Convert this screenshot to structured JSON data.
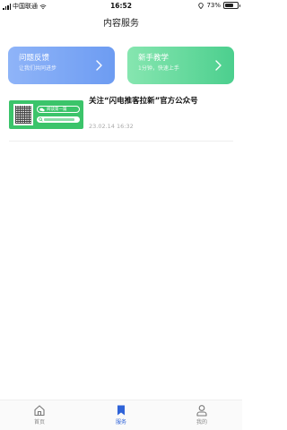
{
  "status_bar": {
    "carrier": "中国联通",
    "time": "16:52",
    "battery": "73%",
    "battery_level": 0.73
  },
  "header": {
    "title": "内容服务"
  },
  "cards": {
    "feedback": {
      "title": "问题反馈",
      "subtitle": "让我们共同进步",
      "color": "#7aa6f5"
    },
    "guide": {
      "title": "新手教学",
      "subtitle": "1分钟，快速上手",
      "color": "#5fd89a"
    }
  },
  "articles": [
    {
      "title": "关注“闪电推客拉新”官方公众号",
      "date": "23.02.14 16:32",
      "thumb_label": "阅读第一篇"
    }
  ],
  "tabbar": {
    "items": [
      {
        "label": "首页",
        "icon": "home-icon",
        "active": false
      },
      {
        "label": "服务",
        "icon": "bookmark-icon",
        "active": true
      },
      {
        "label": "我的",
        "icon": "user-icon",
        "active": false
      }
    ],
    "active_color": "#2f63d8"
  }
}
